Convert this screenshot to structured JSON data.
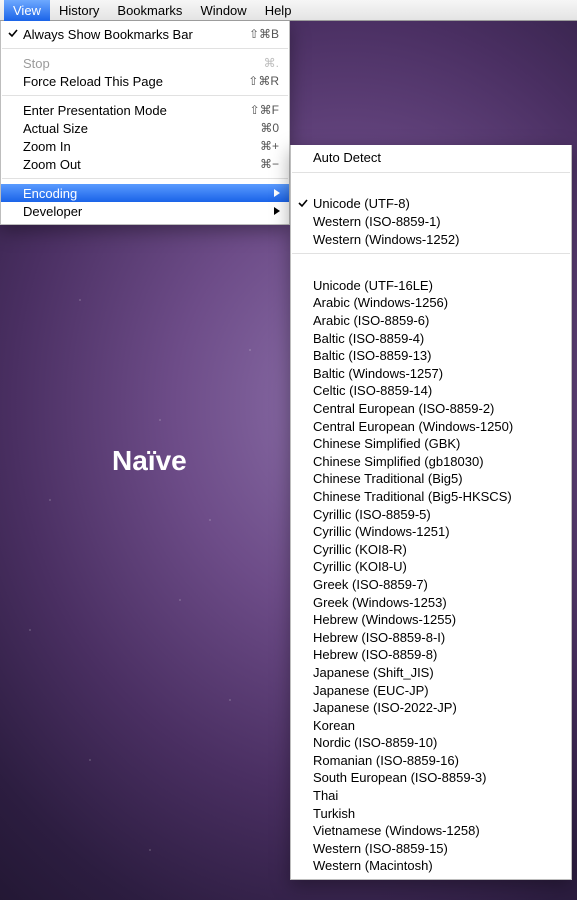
{
  "menubar": [
    "View",
    "History",
    "Bookmarks",
    "Window",
    "Help"
  ],
  "viewMenu": [
    {
      "label": "Always Show Bookmarks Bar",
      "shortcut": "⇧⌘B",
      "checked": true
    },
    {
      "sep": true
    },
    {
      "label": "Stop",
      "shortcut": "⌘.",
      "disabled": true
    },
    {
      "label": "Force Reload This Page",
      "shortcut": "⇧⌘R"
    },
    {
      "sep": true
    },
    {
      "label": "Enter Presentation Mode",
      "shortcut": "⇧⌘F"
    },
    {
      "label": "Actual Size",
      "shortcut": "⌘0"
    },
    {
      "label": "Zoom In",
      "shortcut": "⌘+"
    },
    {
      "label": "Zoom Out",
      "shortcut": "⌘−"
    },
    {
      "sep": true
    },
    {
      "label": "Encoding",
      "submenu": true,
      "hl": true
    },
    {
      "label": "Developer",
      "submenu": true
    }
  ],
  "encMenu": [
    {
      "label": "Auto Detect"
    },
    {
      "sep": true
    },
    {
      "label": "Unicode (UTF-8)",
      "checked": true
    },
    {
      "label": "Western (ISO-8859-1)"
    },
    {
      "label": "Western (Windows-1252)"
    },
    {
      "sep": true
    },
    {
      "label": "Unicode (UTF-16LE)"
    },
    {
      "label": "Arabic (Windows-1256)"
    },
    {
      "label": "Arabic (ISO-8859-6)"
    },
    {
      "label": "Baltic (ISO-8859-4)"
    },
    {
      "label": "Baltic (ISO-8859-13)"
    },
    {
      "label": "Baltic (Windows-1257)"
    },
    {
      "label": "Celtic (ISO-8859-14)"
    },
    {
      "label": "Central European (ISO-8859-2)"
    },
    {
      "label": "Central European (Windows-1250)"
    },
    {
      "label": "Chinese Simplified (GBK)"
    },
    {
      "label": "Chinese Simplified (gb18030)"
    },
    {
      "label": "Chinese Traditional (Big5)"
    },
    {
      "label": "Chinese Traditional (Big5-HKSCS)"
    },
    {
      "label": "Cyrillic (ISO-8859-5)"
    },
    {
      "label": "Cyrillic (Windows-1251)"
    },
    {
      "label": "Cyrillic (KOI8-R)"
    },
    {
      "label": "Cyrillic (KOI8-U)"
    },
    {
      "label": "Greek (ISO-8859-7)"
    },
    {
      "label": "Greek (Windows-1253)"
    },
    {
      "label": "Hebrew (Windows-1255)"
    },
    {
      "label": "Hebrew (ISO-8859-8-I)"
    },
    {
      "label": "Hebrew (ISO-8859-8)"
    },
    {
      "label": "Japanese (Shift_JIS)"
    },
    {
      "label": "Japanese (EUC-JP)"
    },
    {
      "label": "Japanese (ISO-2022-JP)"
    },
    {
      "label": "Korean"
    },
    {
      "label": "Nordic (ISO-8859-10)"
    },
    {
      "label": "Romanian (ISO-8859-16)"
    },
    {
      "label": "South European (ISO-8859-3)"
    },
    {
      "label": "Thai"
    },
    {
      "label": "Turkish"
    },
    {
      "label": "Vietnamese (Windows-1258)"
    },
    {
      "label": "Western (ISO-8859-15)"
    },
    {
      "label": "Western (Macintosh)"
    }
  ],
  "desktopText": "Naïve"
}
